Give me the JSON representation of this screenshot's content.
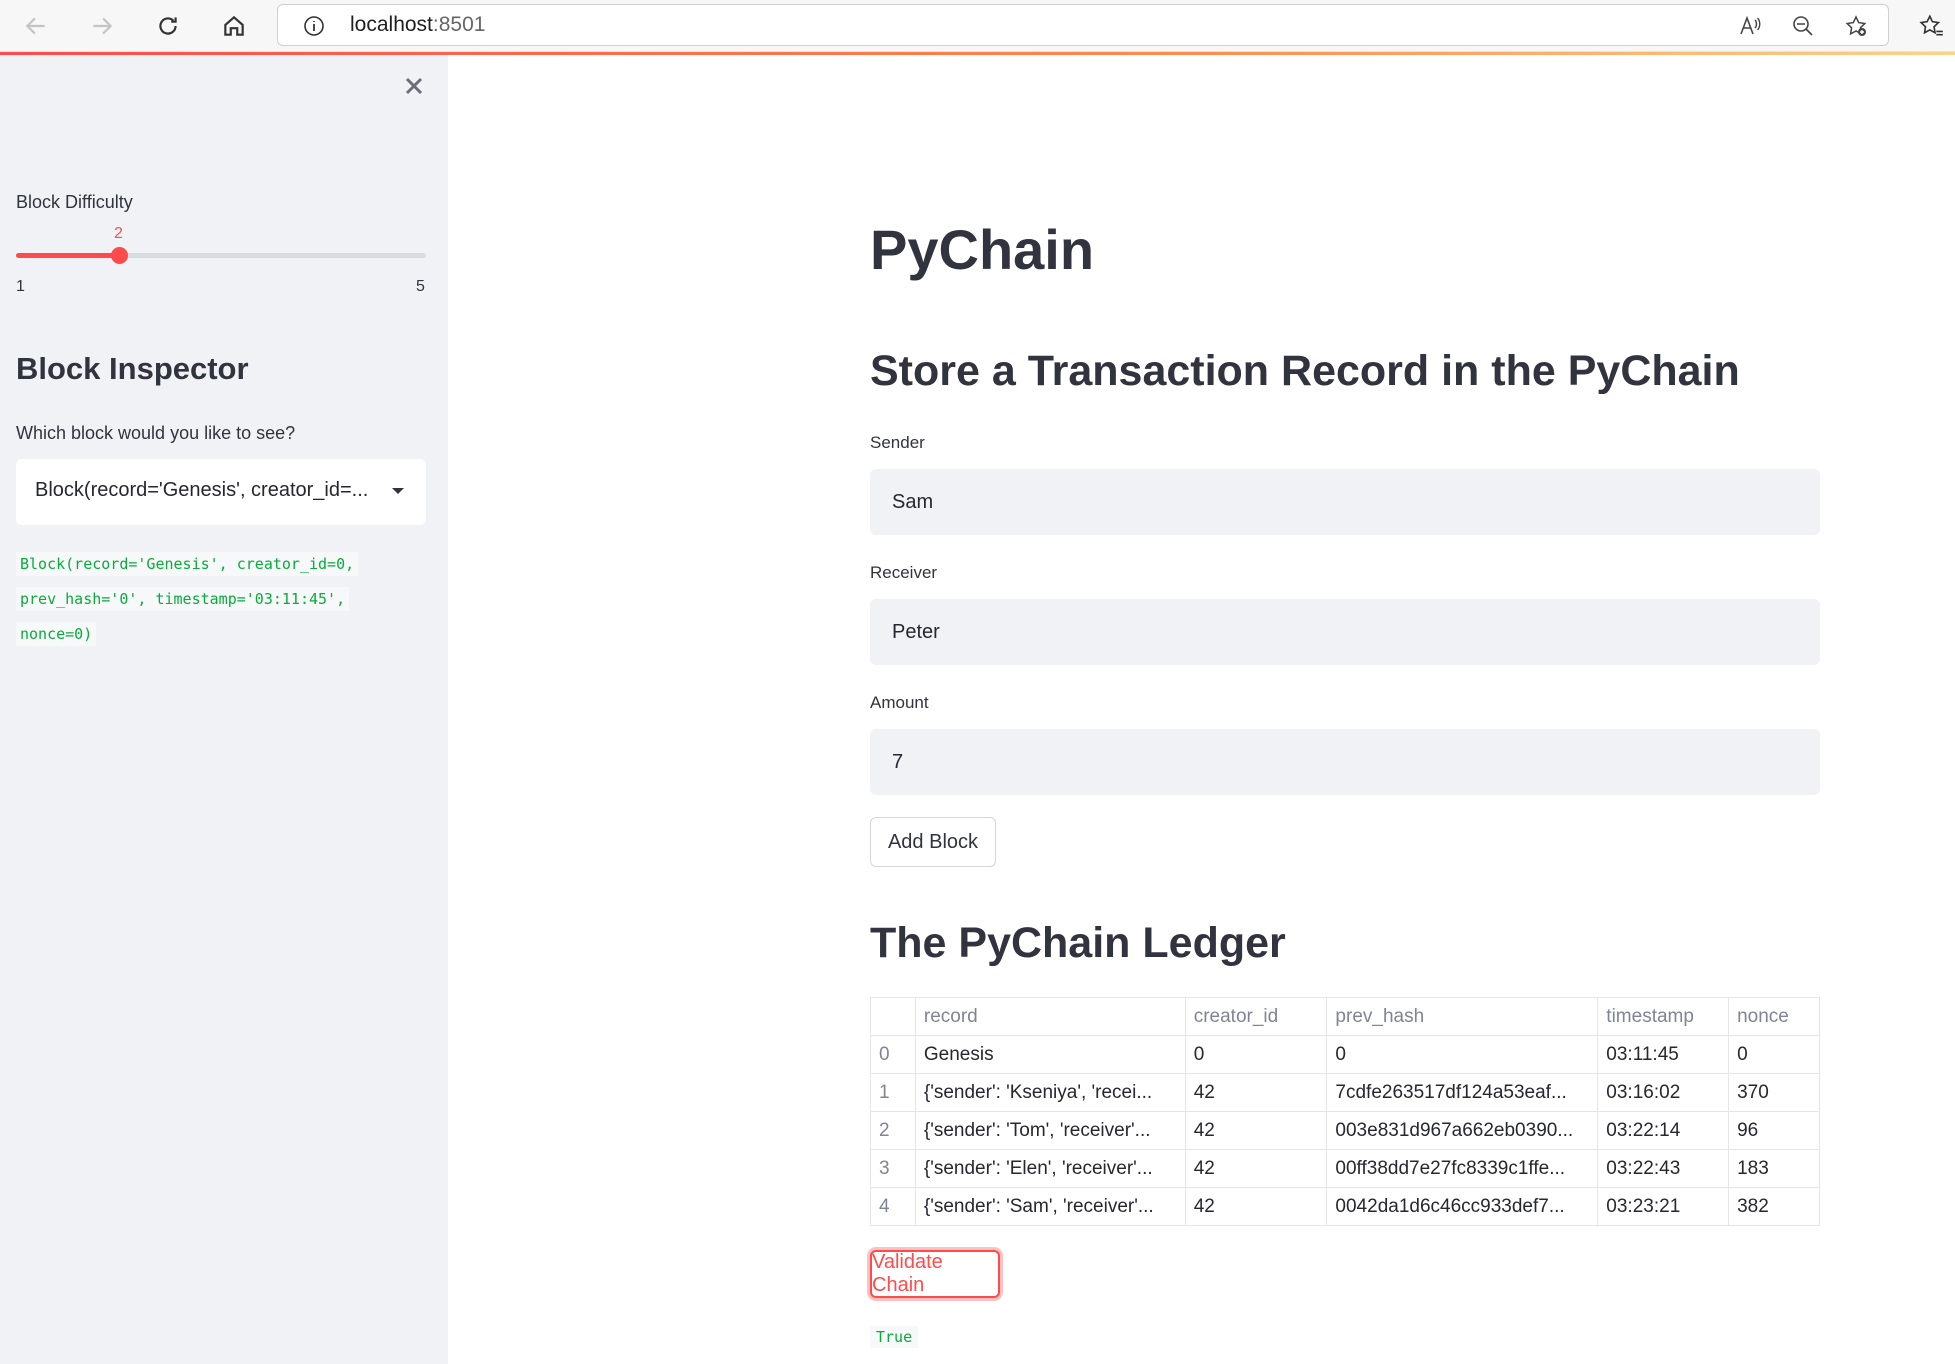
{
  "browser": {
    "url_host": "localhost",
    "url_port": ":8501"
  },
  "sidebar": {
    "difficulty_label": "Block Difficulty",
    "difficulty_value": "2",
    "difficulty_min": "1",
    "difficulty_max": "5",
    "difficulty_fraction": 0.25,
    "inspector_title": "Block Inspector",
    "select_label": "Which block would you like to see?",
    "select_value": "Block(record='Genesis', creator_id=...",
    "block_code": [
      "Block(record='Genesis', creator_id=0,",
      "prev_hash='0', timestamp='03:11:45',",
      "nonce=0)"
    ]
  },
  "main": {
    "title": "PyChain",
    "store_heading": "Store a Transaction Record in the PyChain",
    "sender_label": "Sender",
    "sender_value": "Sam",
    "receiver_label": "Receiver",
    "receiver_value": "Peter",
    "amount_label": "Amount",
    "amount_value": "7",
    "add_block_label": "Add Block",
    "ledger_heading": "The PyChain Ledger",
    "ledger": {
      "columns": [
        "",
        "record",
        "creator_id",
        "prev_hash",
        "timestamp",
        "nonce"
      ],
      "rows": [
        [
          "0",
          "Genesis",
          "0",
          "0",
          "03:11:45",
          "0"
        ],
        [
          "1",
          "{'sender': 'Kseniya', 'recei...",
          "42",
          "7cdfe263517df124a53eaf...",
          "03:16:02",
          "370"
        ],
        [
          "2",
          "{'sender': 'Tom', 'receiver'...",
          "42",
          "003e831d967a662eb0390...",
          "03:22:14",
          "96"
        ],
        [
          "3",
          "{'sender': 'Elen', 'receiver'...",
          "42",
          "00ff38dd7e27fc8339c1ffe...",
          "03:22:43",
          "183"
        ],
        [
          "4",
          "{'sender': 'Sam', 'receiver'...",
          "42",
          "0042da1d6c46cc933def7...",
          "03:23:21",
          "382"
        ]
      ]
    },
    "validate_label": "Validate Chain",
    "validate_result": "True"
  }
}
